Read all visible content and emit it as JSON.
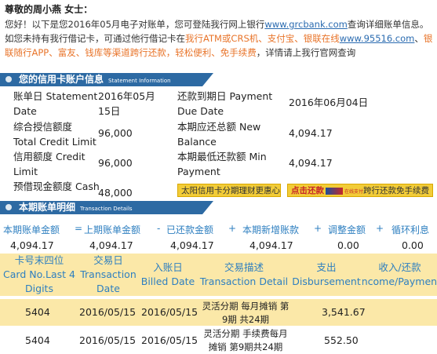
{
  "greeting": "尊敬的周小燕 女士：",
  "intro": {
    "line1_prefix": "您好！以下是您2016年05月电子对账单，您可登陆我行网上银行",
    "website": "www.grcbank.com",
    "line1_suffix": "查询详细账单信息。如您未持有我行借记卡，可通过他行借记卡在",
    "channels_orange_1": "我行ATM或CRS机、支付宝、银联在线",
    "unionpay_site": "www.95516.com",
    "sep": "、",
    "channels_orange_2": "银联随行APP、富友、钱库等渠道跨行还款，轻松便利、免手续费",
    "line2_suffix": "，详情请上我行官网查询"
  },
  "account_section": {
    "title": "您的信用卡账户信息",
    "subtitle": "Statement Information"
  },
  "account_info": {
    "statement_date_label": "账单日 Statement Date",
    "statement_date": "2016年05月15日",
    "due_date_label": "还款到期日 Payment Due Date",
    "due_date": "2016年06月04日",
    "total_credit_label": "综合授信额度 Total Credit Limit",
    "total_credit": "96,000",
    "new_balance_label": "本期应还总额 New Balance",
    "new_balance": "4,094.17",
    "credit_limit_label": "信用额度 Credit Limit",
    "credit_limit": "96,000",
    "min_payment_label": "本期最低还款额 Min Payment",
    "min_payment": "4,094.17",
    "cash_advance_label": "预借现金额度 Cash",
    "cash_advance": "48,000"
  },
  "promo_buttons": {
    "installment": "太阳信用卡分期理财更惠心",
    "pay_prefix": "点击还款",
    "pay_tiny": "在线支付",
    "pay_suffix": "跨行还款免手续费"
  },
  "txn_section": {
    "title": "本期账单明细",
    "subtitle": "Transaction Details"
  },
  "summary": {
    "headers": [
      "本期账单金额",
      "上期账单金额",
      "已还款金额",
      "本期新增账款",
      "调整金额",
      "循环利息"
    ],
    "operators": [
      "=",
      "-",
      "+",
      "+",
      "+"
    ],
    "values": [
      "4,094.17",
      "4,094.17",
      "4,094.17",
      "4,094.17",
      "0.00",
      "0.00"
    ]
  },
  "txn_table": {
    "headers": [
      {
        "cn": "卡号末四位",
        "en": "Card No.Last 4 Digits"
      },
      {
        "cn": "交易日",
        "en": "Transaction Date"
      },
      {
        "cn": "入账日",
        "en": "Billed Date"
      },
      {
        "cn": "交易描述",
        "en": "Transaction Detail"
      },
      {
        "cn": "支出",
        "en": "Disbursement"
      },
      {
        "cn": "收入/还款",
        "en": "Income/Payment"
      }
    ],
    "rows": [
      {
        "card": "5404",
        "txn_date": "2016/05/15",
        "billed_date": "2016/05/15",
        "detail": "灵活分期 每月摊销 第9期 共24期",
        "disbursement": "3,541.67",
        "income": ""
      },
      {
        "card": "5404",
        "txn_date": "2016/05/15",
        "billed_date": "2016/05/15",
        "detail": "灵活分期 手续费每月摊销 第9期共24期",
        "disbursement": "552.50",
        "income": ""
      }
    ]
  }
}
